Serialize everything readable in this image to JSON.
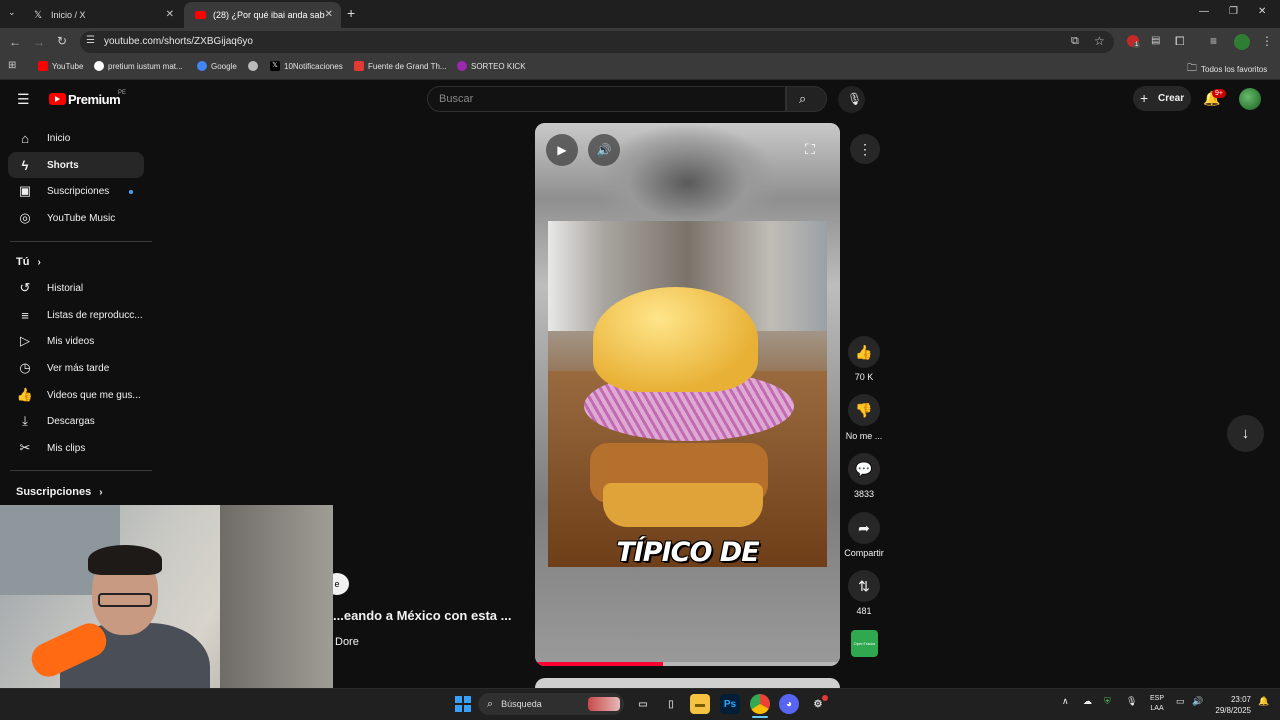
{
  "browser": {
    "tabs": [
      {
        "title": "Inicio / X",
        "icon": "x-logo-icon"
      },
      {
        "title": "(28) ¿Por qué ibai anda sabote...",
        "icon": "youtube-icon"
      }
    ],
    "new_tab": "+",
    "url": "youtube.com/shorts/ZXBGijaq6yo",
    "bookmarks": [
      {
        "label": "YouTube",
        "color": "#ff0000"
      },
      {
        "label": "pretium iustum mat...",
        "color": "#ffffff"
      },
      {
        "label": "Google",
        "color": "#4285f4"
      },
      {
        "label": "",
        "color": "#bbbbbb"
      },
      {
        "label": "10Notificaciones",
        "color": "#000000"
      },
      {
        "label": "Fuente de Grand Th...",
        "color": "#e53935"
      },
      {
        "label": "SORTEO KICK",
        "color": "#9c27b0"
      }
    ],
    "all_bookmarks": "Todos los favoritos",
    "extension_badge": "1"
  },
  "youtube": {
    "logo_text": "Premium",
    "logo_region": "PE",
    "search_placeholder": "Buscar",
    "create_label": "Crear",
    "notifications_count": "9+",
    "sidebar": {
      "main": [
        {
          "label": "Inicio",
          "icon": "home-icon"
        },
        {
          "label": "Shorts",
          "icon": "shorts-icon",
          "active": true
        },
        {
          "label": "Suscripciones",
          "icon": "subscriptions-icon",
          "dot": true
        },
        {
          "label": "YouTube Music",
          "icon": "music-icon"
        }
      ],
      "you_heading": "Tú",
      "you": [
        {
          "label": "Historial",
          "icon": "history-icon"
        },
        {
          "label": "Listas de reproducc...",
          "icon": "playlist-icon"
        },
        {
          "label": "Mis videos",
          "icon": "my-videos-icon"
        },
        {
          "label": "Ver más tarde",
          "icon": "clock-icon"
        },
        {
          "label": "Videos que me gus...",
          "icon": "like-icon"
        },
        {
          "label": "Descargas",
          "icon": "download-icon"
        },
        {
          "label": "Mis clips",
          "icon": "scissors-icon"
        }
      ],
      "subs_heading": "Suscripciones"
    },
    "short": {
      "overlay_text": "TÍPICO DE",
      "progress": 0.42,
      "likes": "70 K",
      "dislike_label": "No me ...",
      "comments": "3833",
      "share_label": "Compartir",
      "remix_count": "481",
      "audio_thumb_text": "OpenTracks"
    },
    "behind_webcam": {
      "title": "...eando a México con esta ...",
      "channel": "Dore",
      "badge": "e"
    }
  },
  "taskbar": {
    "search_label": "Búsqueda",
    "lang_top": "ESP",
    "lang_bottom": "LAA",
    "time": "23:07",
    "date": "29/8/2025",
    "apps": [
      {
        "label": "Ps",
        "color": "#001e36",
        "text_color": "#31a8ff"
      }
    ]
  }
}
